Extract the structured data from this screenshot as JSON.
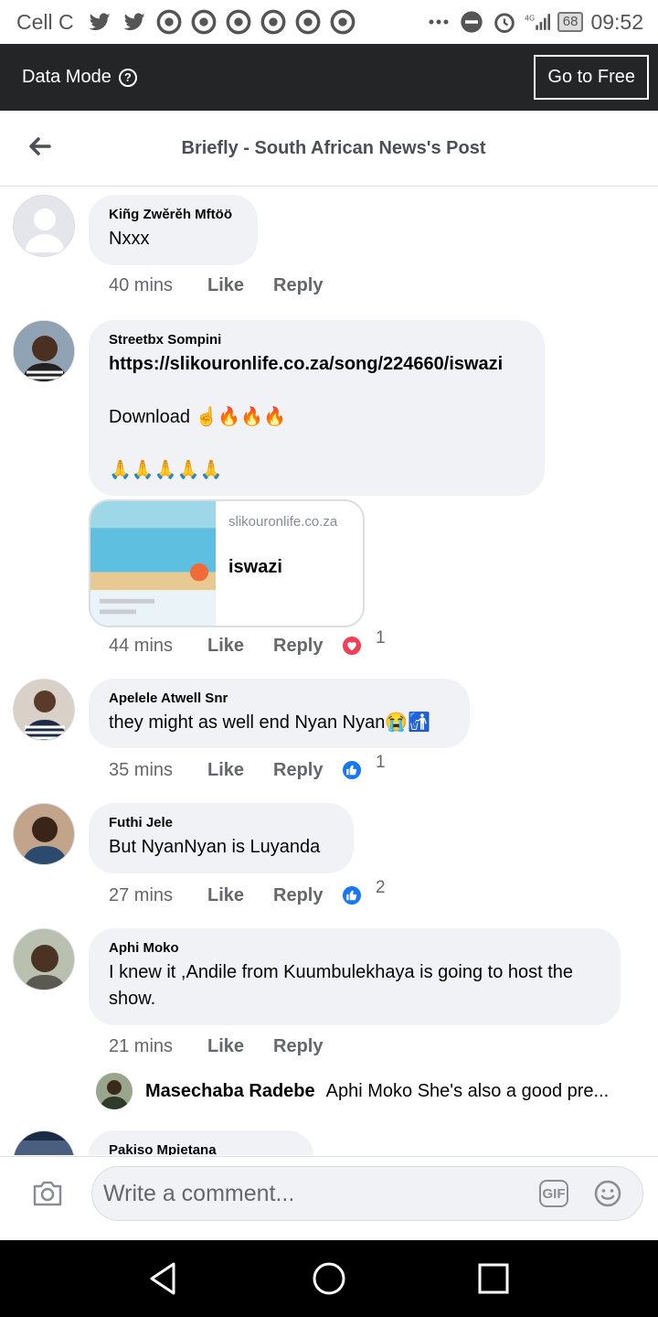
{
  "status_bar": {
    "carrier": "Cell C",
    "network": "4G",
    "battery": "68",
    "time": "09:52"
  },
  "data_mode": {
    "label": "Data Mode",
    "help_icon": "question-circle-icon",
    "go_free_label": "Go to Free"
  },
  "header": {
    "title": "Briefly - South African News's Post",
    "back_icon": "arrow-left-icon"
  },
  "comments": [
    {
      "author": "Kiñg Zwěrěh Mftöö",
      "text": "Nxxx",
      "time": "40 mins",
      "like": "Like",
      "reply": "Reply"
    },
    {
      "author": "Streetbx Sompini",
      "link_text": "https://slikouronlife.co.za/song/224660/iswazi",
      "text": "Download ☝🔥🔥🔥\n\n🙏🙏🙏🙏🙏",
      "link_card": {
        "domain": "slikouronlife.co.za",
        "title": "iswazi"
      },
      "time": "44 mins",
      "like": "Like",
      "reply": "Reply",
      "reaction": "heart",
      "reaction_count": "1"
    },
    {
      "author": "Apelele Atwell Snr",
      "text": "they might as well end Nyan Nyan😭🚮",
      "time": "35 mins",
      "like": "Like",
      "reply": "Reply",
      "reaction": "thumbs-up",
      "reaction_count": "1"
    },
    {
      "author": "Futhi Jele",
      "text": "But NyanNyan is Luyanda",
      "time": "27 mins",
      "like": "Like",
      "reply": "Reply",
      "reaction": "thumbs-up",
      "reaction_count": "2"
    },
    {
      "author": "Aphi Moko",
      "text": "I knew it ,Andile from Kuumbulekhaya is going to host the show.",
      "time": "21 mins",
      "like": "Like",
      "reply": "Reply"
    },
    {
      "author": "Pakiso Mpietana"
    }
  ],
  "reply_preview": {
    "author": "Masechaba Radebe",
    "text": "Aphi Moko She's also a good pre..."
  },
  "composer": {
    "placeholder": "Write a comment...",
    "gif_label": "GIF"
  },
  "colors": {
    "dark_bar": "#242526",
    "bubble": "#f0f2f5",
    "muted_text": "#65676b",
    "like_blue": "#1877f2",
    "love_red": "#f33e58"
  }
}
